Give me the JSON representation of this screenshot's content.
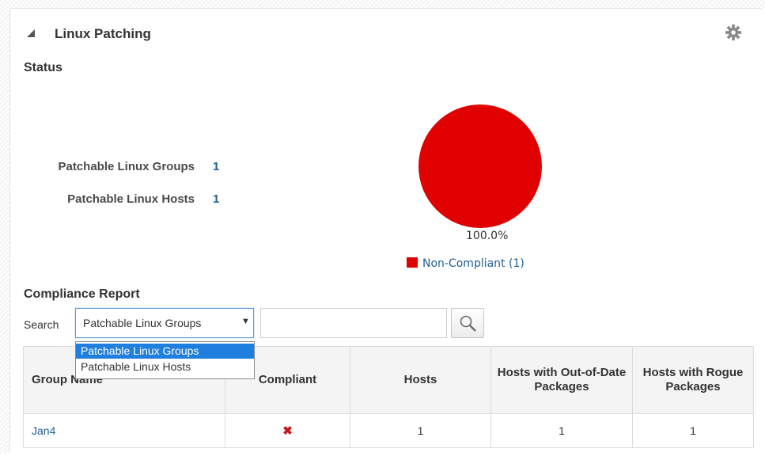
{
  "header": {
    "title": "Linux Patching"
  },
  "status": {
    "title": "Status",
    "stats": [
      {
        "label": "Patchable Linux Groups",
        "value": "1"
      },
      {
        "label": "Patchable Linux Hosts",
        "value": "1"
      }
    ],
    "chart_data": {
      "type": "pie",
      "slices": [
        {
          "name": "Non-Compliant (1)",
          "value": 100.0,
          "color": "#e00000"
        }
      ],
      "labels": [
        "100.0%"
      ],
      "legend": "bottom"
    },
    "pie_label": "100.0%",
    "legend_label": "Non-Compliant (1)"
  },
  "report": {
    "title": "Compliance Report",
    "search_label": "Search",
    "select_value": "Patchable Linux Groups",
    "select_arrow": "▼",
    "search_input_value": "",
    "dropdown_options": [
      "Patchable Linux Groups",
      "Patchable Linux Hosts"
    ],
    "columns": [
      "Group Name",
      "Compliant",
      "Hosts",
      "Hosts with Out-of-Date Packages",
      "Hosts with Rogue Packages"
    ],
    "rows": [
      {
        "group_name": "Jan4",
        "compliant": "✖",
        "hosts": "1",
        "out_of_date": "1",
        "rogue": "1"
      }
    ]
  },
  "colors": {
    "accent_link": "#1f5f97",
    "non_compliant": "#e00000",
    "selection": "#1e7fde"
  },
  "icons": [
    "collapse-triangle-icon",
    "gear-icon",
    "search-icon",
    "x-mark-icon"
  ]
}
